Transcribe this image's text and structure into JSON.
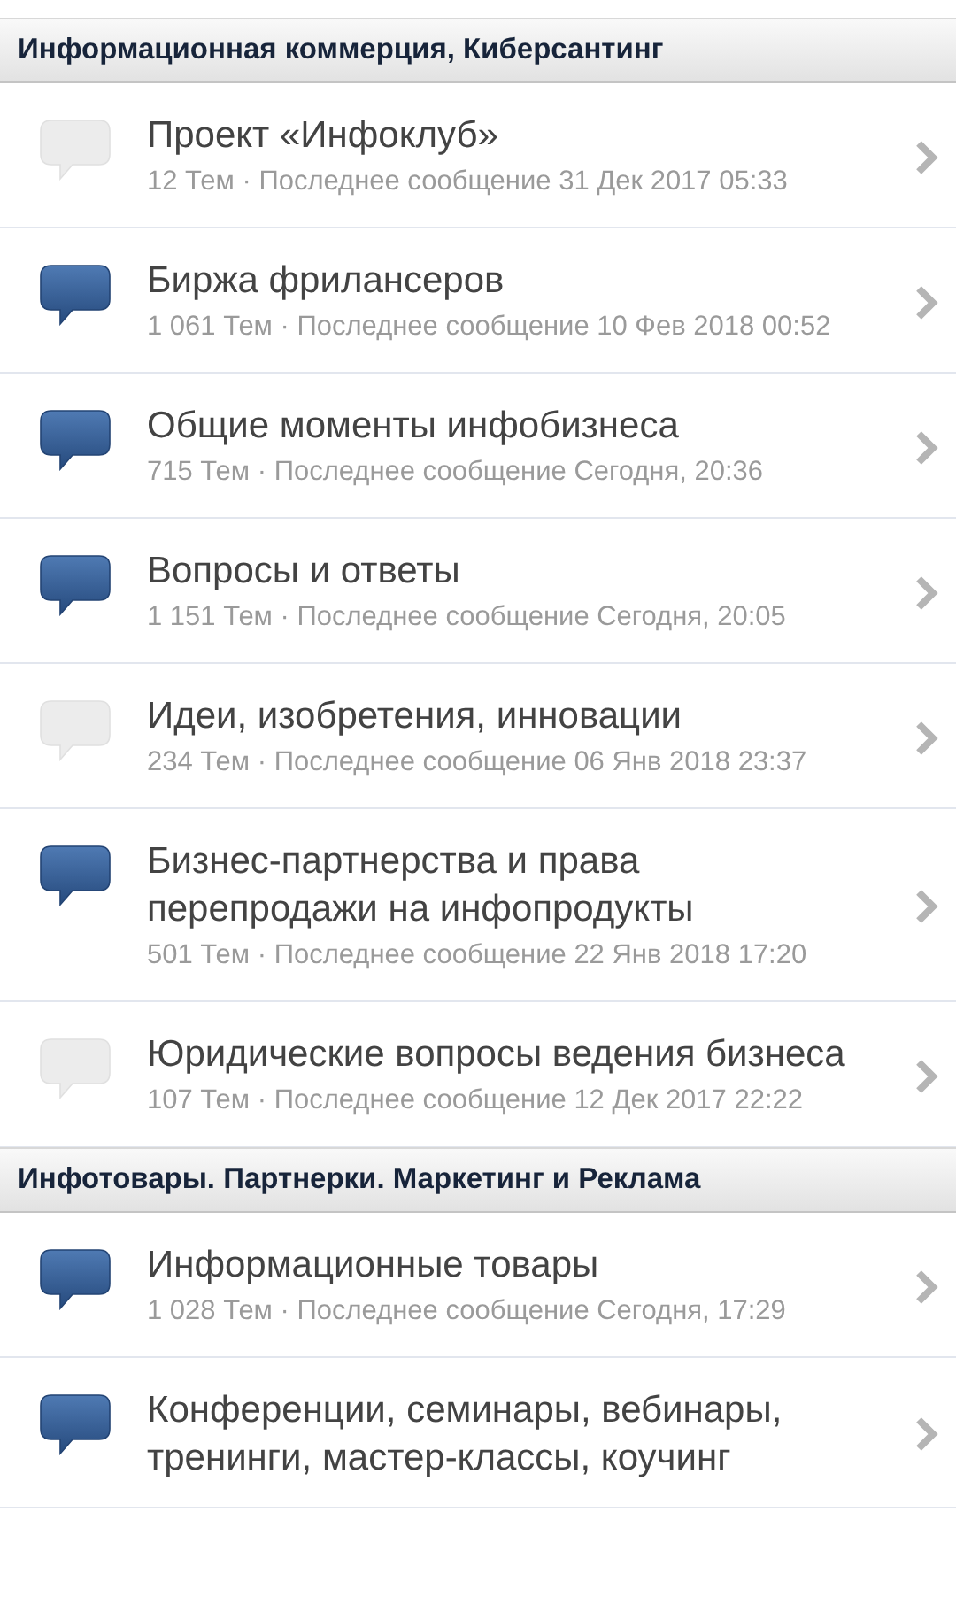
{
  "sections": [
    {
      "title": "Информационная коммерция, Киберсантинг",
      "forums": [
        {
          "title": "Проект «Инфоклуб»",
          "meta": "12 Тем · Последнее сообщение 31 Дек 2017 05:33",
          "unread": false
        },
        {
          "title": "Биржа фрилансеров",
          "meta": "1 061 Тем · Последнее сообщение 10 Фев 2018 00:52",
          "unread": true
        },
        {
          "title": "Общие моменты инфобизнеса",
          "meta": "715 Тем · Последнее сообщение Сегодня, 20:36",
          "unread": true
        },
        {
          "title": "Вопросы и ответы",
          "meta": "1 151 Тем · Последнее сообщение Сегодня, 20:05",
          "unread": true
        },
        {
          "title": "Идеи, изобретения, инновации",
          "meta": "234 Тем · Последнее сообщение 06 Янв 2018 23:37",
          "unread": false
        },
        {
          "title": "Бизнес-партнерства и права перепродажи на инфопродукты",
          "meta": "501 Тем · Последнее сообщение 22 Янв 2018 17:20",
          "unread": true
        },
        {
          "title": "Юридические вопросы ведения бизнеса",
          "meta": "107 Тем · Последнее сообщение 12 Дек 2017 22:22",
          "unread": false
        }
      ]
    },
    {
      "title": "Инфотовары. Партнерки. Маркетинг и Реклама",
      "forums": [
        {
          "title": "Информационные товары",
          "meta": "1 028 Тем · Последнее сообщение Сегодня, 17:29",
          "unread": true
        },
        {
          "title": "Конференции, семинары, вебинары, тренинги, мастер-классы, коучинг",
          "unread": true
        }
      ]
    }
  ]
}
